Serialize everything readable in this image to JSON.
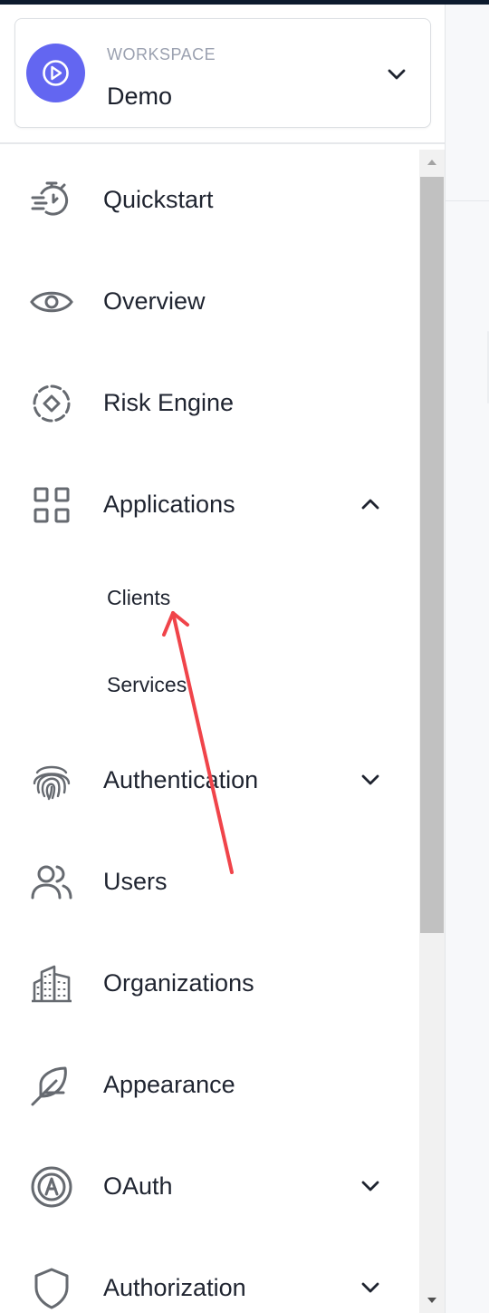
{
  "workspace": {
    "label": "WORKSPACE",
    "name": "Demo",
    "avatar_color": "#6366f1",
    "icon": "play-circle-icon",
    "toggle_icon": "chevron-down-icon"
  },
  "nav": {
    "items": [
      {
        "id": "quickstart",
        "label": "Quickstart",
        "icon": "stopwatch-icon"
      },
      {
        "id": "overview",
        "label": "Overview",
        "icon": "eye-icon"
      },
      {
        "id": "risk-engine",
        "label": "Risk Engine",
        "icon": "risk-engine-icon"
      },
      {
        "id": "applications",
        "label": "Applications",
        "icon": "grid-icon",
        "expanded": true,
        "children": [
          {
            "label": "Clients"
          },
          {
            "label": "Services"
          }
        ]
      },
      {
        "id": "authentication",
        "label": "Authentication",
        "icon": "fingerprint-icon",
        "expanded": false
      },
      {
        "id": "users",
        "label": "Users",
        "icon": "users-icon"
      },
      {
        "id": "organizations",
        "label": "Organizations",
        "icon": "buildings-icon"
      },
      {
        "id": "appearance",
        "label": "Appearance",
        "icon": "feather-icon"
      },
      {
        "id": "oauth",
        "label": "OAuth",
        "icon": "oauth-icon",
        "expanded": false
      },
      {
        "id": "authorization",
        "label": "Authorization",
        "icon": "shield-icon",
        "expanded": false
      }
    ]
  },
  "annotation": {
    "arrow_color": "#f0444a",
    "points_to": "Clients"
  },
  "colors": {
    "icon": "#666a70",
    "text": "#1f2430",
    "muted": "#9ba1b0",
    "scroll_thumb": "#c1c1c1"
  }
}
